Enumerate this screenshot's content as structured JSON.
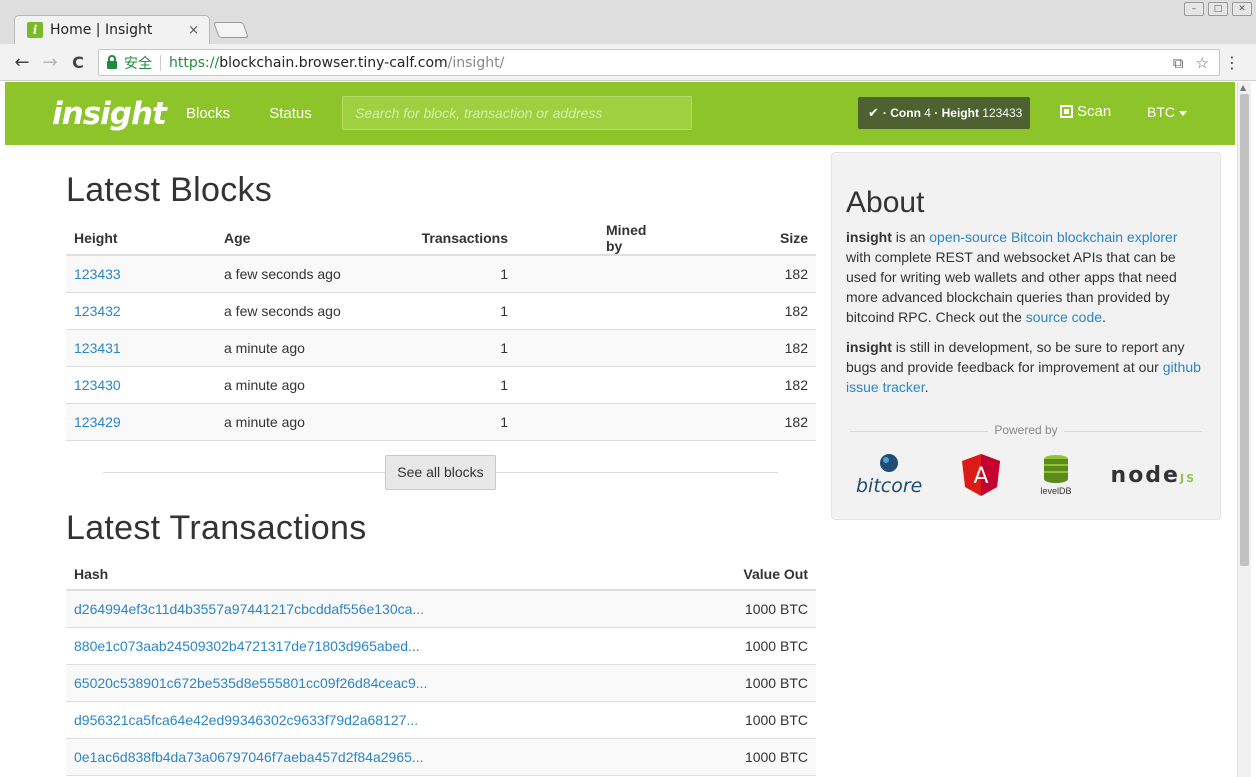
{
  "browser": {
    "tab_title": "Home | Insight",
    "tab_close": "×",
    "favicon_letter": "i",
    "secure_label": "安全",
    "url_scheme": "https://",
    "url_host": "blockchain.browser.tiny-calf.com",
    "url_path": "/insight/",
    "back_glyph": "←",
    "forward_glyph": "→",
    "reload_glyph": "C",
    "translate_glyph": "⧉",
    "star_glyph": "☆",
    "menu_glyph": "⋮"
  },
  "navbar": {
    "brand": "insight",
    "links": [
      "Blocks",
      "Status"
    ],
    "search_placeholder": "Search for block, transaction or address",
    "status": {
      "check": "✔",
      "conn_label": "· Conn",
      "conn": "4",
      "height_label": "· Height",
      "height": "123433"
    },
    "scan": "Scan",
    "currency": "BTC"
  },
  "latest_blocks": {
    "title": "Latest Blocks",
    "columns": [
      "Height",
      "Age",
      "Transactions",
      "Mined by",
      "Size"
    ],
    "rows": [
      {
        "height": "123433",
        "age": "a few seconds ago",
        "transactions": "1",
        "mined_by": "",
        "size": "182"
      },
      {
        "height": "123432",
        "age": "a few seconds ago",
        "transactions": "1",
        "mined_by": "",
        "size": "182"
      },
      {
        "height": "123431",
        "age": "a minute ago",
        "transactions": "1",
        "mined_by": "",
        "size": "182"
      },
      {
        "height": "123430",
        "age": "a minute ago",
        "transactions": "1",
        "mined_by": "",
        "size": "182"
      },
      {
        "height": "123429",
        "age": "a minute ago",
        "transactions": "1",
        "mined_by": "",
        "size": "182"
      }
    ],
    "see_all": "See all blocks"
  },
  "latest_transactions": {
    "title": "Latest Transactions",
    "columns": [
      "Hash",
      "Value Out"
    ],
    "rows": [
      {
        "hash": "d264994ef3c11d4b3557a97441217cbcddaf556e130ca...",
        "value_out": "1000 BTC"
      },
      {
        "hash": "880e1c073aab24509302b4721317de71803d965abed...",
        "value_out": "1000 BTC"
      },
      {
        "hash": "65020c538901c672be535d8e555801cc09f26d84ceac9...",
        "value_out": "1000 BTC"
      },
      {
        "hash": "d956321ca5fca64e42ed99346302c9633f79d2a68127...",
        "value_out": "1000 BTC"
      },
      {
        "hash": "0e1ac6d838fb4da73a06797046f7aeba457d2f84a2965...",
        "value_out": "1000 BTC"
      }
    ]
  },
  "about": {
    "title": "About",
    "p1_brand": "insight",
    "p1_a": " is an ",
    "p1_link": "open-source Bitcoin blockchain explorer",
    "p1_b": " with complete REST and websocket APIs that can be used for writing web wallets and other apps that need more advanced blockchain queries than provided by bitcoind RPC. Check out the ",
    "p1_link2": "source code",
    "p1_c": ".",
    "p2_brand": "insight",
    "p2_a": " is still in development, so be sure to report any bugs and provide feedback for improvement at our ",
    "p2_link": "github issue tracker",
    "p2_b": ".",
    "powered_by": "Powered by",
    "logos": {
      "bitcore": "bitcore",
      "angular": "A",
      "leveldb": "levelDB",
      "node": "node",
      "node_js": "JS"
    }
  },
  "colors": {
    "brand_green": "#8dc429",
    "link_blue": "#2a86c7",
    "status_dark": "#4e6130"
  },
  "icons": [
    "back-arrow-icon",
    "forward-arrow-icon",
    "reload-icon",
    "lock-icon",
    "translate-icon",
    "star-icon",
    "menu-icon",
    "check-icon",
    "qr-code-icon",
    "caret-down-icon"
  ]
}
